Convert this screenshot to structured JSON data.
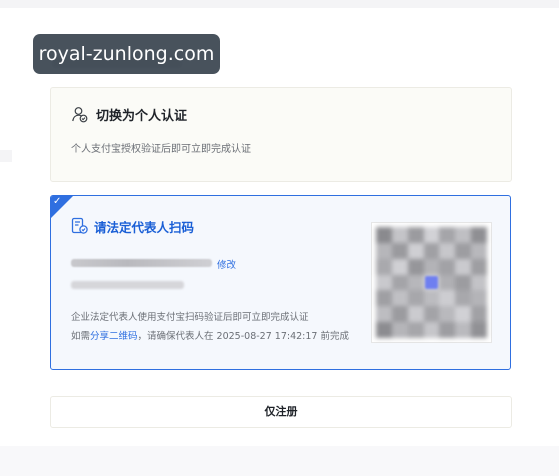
{
  "watermark": {
    "text": "royal-zunlong.com"
  },
  "personal_option": {
    "title": "切换为个人认证",
    "description": "个人支付宝授权验证后即可立即完成认证",
    "icon": "person-verify-icon"
  },
  "legal_option": {
    "title": "请法定代表人扫码",
    "edit_label": "修改",
    "description": "企业法定代表人使用支付宝扫码验证后即可立即完成认证",
    "share_prefix": "如需",
    "share_link": "分享二维码",
    "share_suffix": "，请确保代表人在 2025-08-27 17:42:17 前完成",
    "icon": "scan-verify-icon",
    "accent_color": "#2f6fe0"
  },
  "register_button": {
    "label": "仅注册"
  }
}
